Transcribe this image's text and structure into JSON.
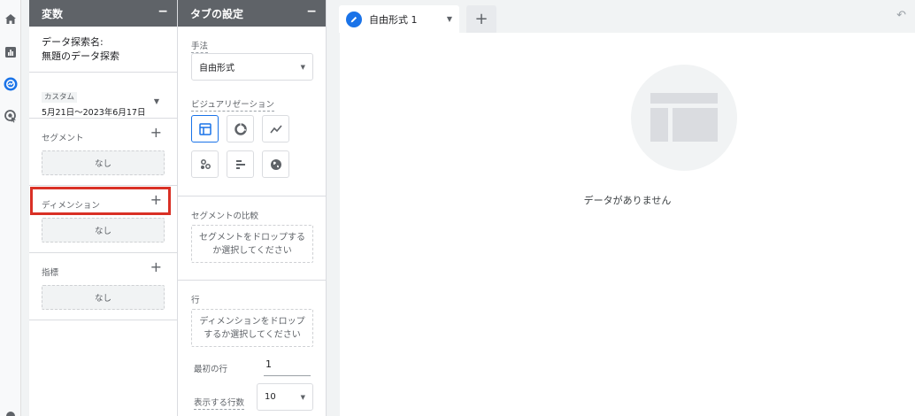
{
  "variables_panel": {
    "title": "変数",
    "minimize": "−",
    "exploration_name_label": "データ探索名:",
    "exploration_name": "無題のデータ探索",
    "date_caption": "カスタム",
    "date_range": "5月21日～2023年6月17日",
    "segments": {
      "title": "セグメント",
      "empty": "なし"
    },
    "dimensions": {
      "title": "ディメンション",
      "empty": "なし"
    },
    "metrics": {
      "title": "指標",
      "empty": "なし"
    }
  },
  "tab_settings": {
    "title": "タブの設定",
    "minimize": "−",
    "technique_label": "手法",
    "technique_value": "自由形式",
    "visualization_label": "ビジュアリゼーション",
    "visualizations": [
      "table-icon",
      "donut-chart-icon",
      "line-chart-icon",
      "scatter-plot-icon",
      "bar-chart-icon",
      "geo-map-icon"
    ],
    "segment_compare_label": "セグメントの比較",
    "segment_drop": "セグメントをドロップするか選択してください",
    "rows_label": "行",
    "rows_drop": "ディメンションをドロップするか選択してください",
    "first_row_label": "最初の行",
    "first_row_value": "1",
    "show_rows_label": "表示する行数",
    "show_rows_value": "10"
  },
  "canvas": {
    "tab_name": "自由形式 1",
    "empty_message": "データがありません"
  },
  "colors": {
    "accent": "#1a73e8",
    "highlight": "#d93025",
    "header": "#5f6368"
  }
}
